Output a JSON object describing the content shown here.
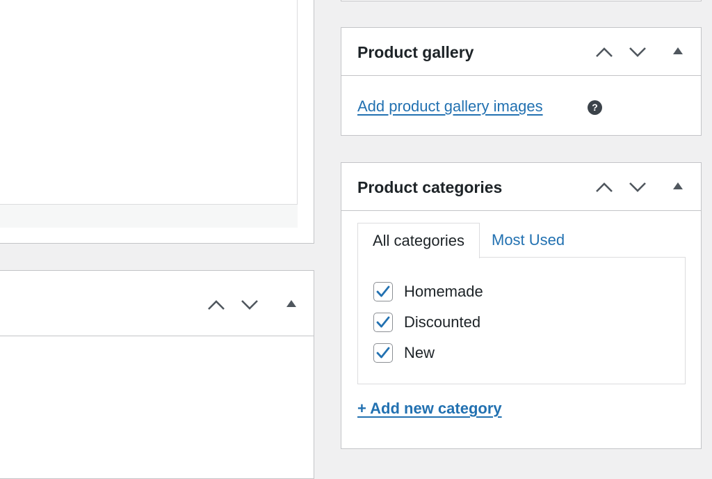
{
  "gallery": {
    "title": "Product gallery",
    "add_link": "Add product gallery images",
    "help_glyph": "?"
  },
  "categories": {
    "title": "Product categories",
    "tabs": [
      {
        "label": "All categories",
        "active": true
      },
      {
        "label": "Most Used",
        "active": false
      }
    ],
    "items": [
      {
        "label": "Homemade",
        "checked": true
      },
      {
        "label": "Discounted",
        "checked": true
      },
      {
        "label": "New",
        "checked": true
      }
    ],
    "add_new_label": "+ Add new category"
  },
  "icons": {
    "move_up": "chevron-up-icon",
    "move_down": "chevron-down-icon",
    "toggle": "triangle-up-icon",
    "help": "question-circle-icon",
    "check": "checkmark-icon"
  },
  "colors": {
    "accent": "#2271b1",
    "text": "#1d2327",
    "border": "#c3c4c7",
    "background": "#f0f0f1",
    "icon_gray": "#50575e"
  }
}
